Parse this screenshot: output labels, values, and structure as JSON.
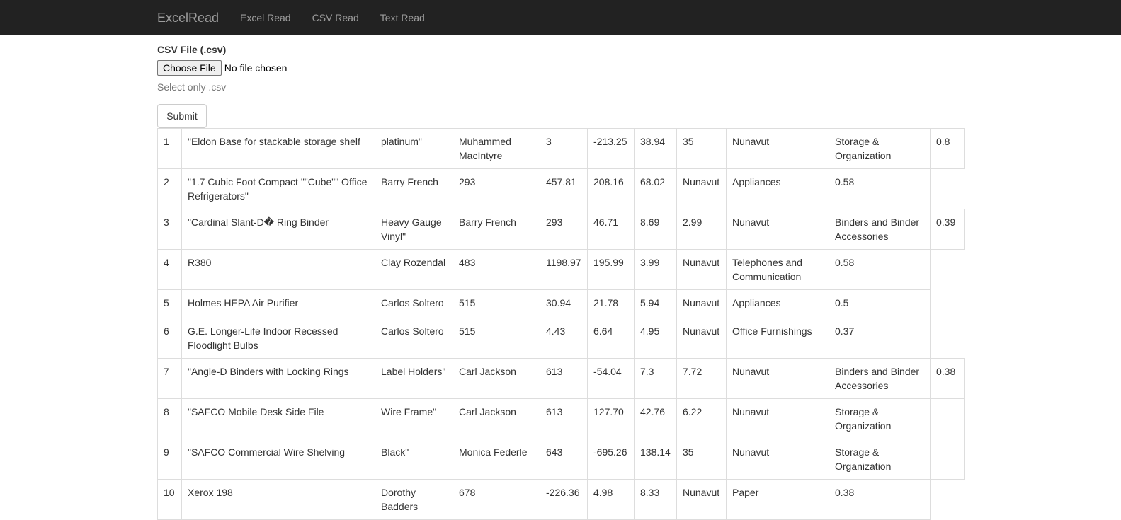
{
  "nav": {
    "brand": "ExcelRead",
    "links": [
      "Excel Read",
      "CSV Read",
      "Text Read"
    ]
  },
  "form": {
    "label": "CSV File (.csv)",
    "choose_button": "Choose File",
    "file_status": "No file chosen",
    "help": "Select only .csv",
    "submit": "Submit"
  },
  "table": {
    "rows": [
      [
        "1",
        "\"Eldon Base for stackable storage shelf",
        "platinum\"",
        "Muhammed MacIntyre",
        "3",
        "-213.25",
        "38.94",
        "35",
        "Nunavut",
        "Storage & Organization",
        "0.8"
      ],
      [
        "2",
        "\"1.7 Cubic Foot Compact \"\"Cube\"\" Office Refrigerators\"",
        "Barry French",
        "293",
        "457.81",
        "208.16",
        "68.02",
        "Nunavut",
        "Appliances",
        "0.58"
      ],
      [
        "3",
        "\"Cardinal Slant-D� Ring Binder",
        "Heavy Gauge Vinyl\"",
        "Barry French",
        "293",
        "46.71",
        "8.69",
        "2.99",
        "Nunavut",
        "Binders and Binder Accessories",
        "0.39"
      ],
      [
        "4",
        "R380",
        "Clay Rozendal",
        "483",
        "1198.97",
        "195.99",
        "3.99",
        "Nunavut",
        "Telephones and Communication",
        "0.58"
      ],
      [
        "5",
        "Holmes HEPA Air Purifier",
        "Carlos Soltero",
        "515",
        "30.94",
        "21.78",
        "5.94",
        "Nunavut",
        "Appliances",
        "0.5"
      ],
      [
        "6",
        "G.E. Longer-Life Indoor Recessed Floodlight Bulbs",
        "Carlos Soltero",
        "515",
        "4.43",
        "6.64",
        "4.95",
        "Nunavut",
        "Office Furnishings",
        "0.37"
      ],
      [
        "7",
        "\"Angle-D Binders with Locking Rings",
        "Label Holders\"",
        "Carl Jackson",
        "613",
        "-54.04",
        "7.3",
        "7.72",
        "Nunavut",
        "Binders and Binder Accessories",
        "0.38"
      ],
      [
        "8",
        "\"SAFCO Mobile Desk Side File",
        "Wire Frame\"",
        "Carl Jackson",
        "613",
        "127.70",
        "42.76",
        "6.22",
        "Nunavut",
        "Storage & Organization",
        ""
      ],
      [
        "9",
        "\"SAFCO Commercial Wire Shelving",
        "Black\"",
        "Monica Federle",
        "643",
        "-695.26",
        "138.14",
        "35",
        "Nunavut",
        "Storage & Organization",
        ""
      ],
      [
        "10",
        "Xerox 198",
        "Dorothy Badders",
        "678",
        "-226.36",
        "4.98",
        "8.33",
        "Nunavut",
        "Paper",
        "0.38"
      ]
    ]
  }
}
